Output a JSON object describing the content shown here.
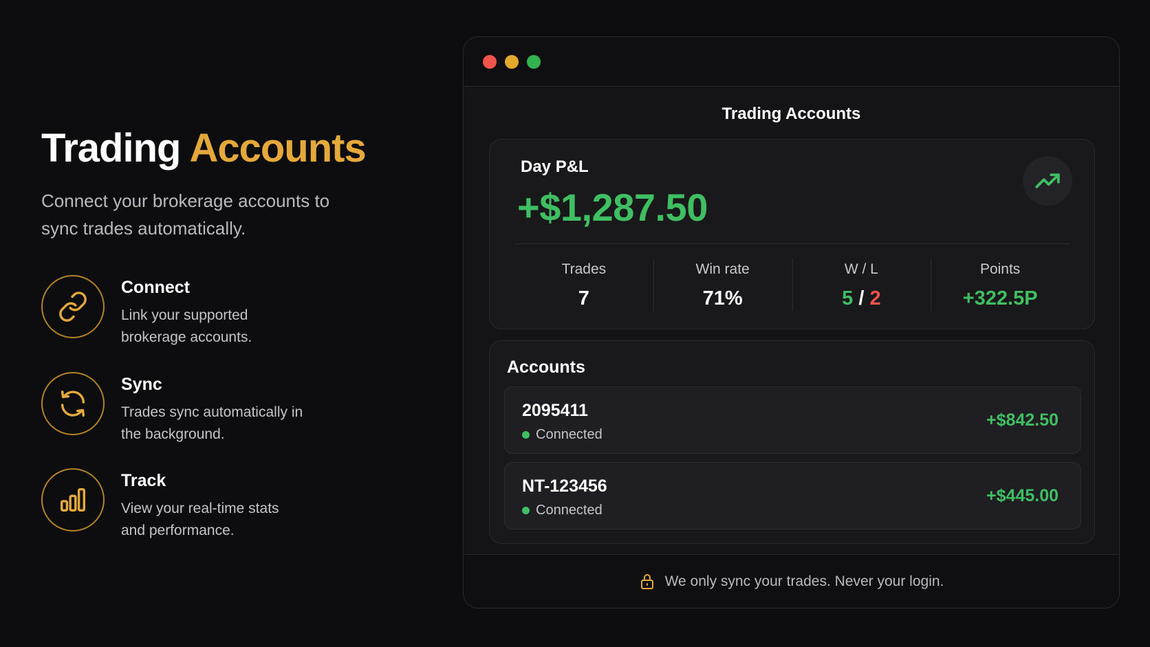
{
  "hero": {
    "title_main": "Trading",
    "title_accent": "Accounts",
    "subtitle": "Connect your brokerage accounts to sync trades automatically."
  },
  "features": [
    {
      "icon": "link-icon",
      "title": "Connect",
      "description": "Link your supported brokerage accounts."
    },
    {
      "icon": "sync-icon",
      "title": "Sync",
      "description": "Trades sync automatically in the background."
    },
    {
      "icon": "bar-chart-icon",
      "title": "Track",
      "description": "View your real-time stats and performance."
    }
  ],
  "window": {
    "title": "Trading Accounts",
    "pnl": {
      "label": "Day P&L",
      "value": "+$1,287.50",
      "icon": "trending-up-icon"
    },
    "stats": {
      "trades": {
        "label": "Trades",
        "value": "7"
      },
      "win_rate": {
        "label": "Win rate",
        "value": "71%"
      },
      "wl": {
        "label": "W / L",
        "wins": "5",
        "separator": " / ",
        "losses": "2"
      },
      "points": {
        "label": "Points",
        "value": "+322.5P"
      }
    },
    "accounts": {
      "title": "Accounts",
      "items": [
        {
          "id": "2095411",
          "status": "Connected",
          "pnl": "+$842.50"
        },
        {
          "id": "NT-123456",
          "status": "Connected",
          "pnl": "+$445.00"
        }
      ]
    },
    "footer": {
      "icon": "lock-icon",
      "text": "We only sync your trades. Never your login."
    }
  },
  "colors": {
    "accent": "#e4a93a",
    "positive": "#3fbf62",
    "negative": "#f0544b",
    "background": "#0d0d0f"
  }
}
